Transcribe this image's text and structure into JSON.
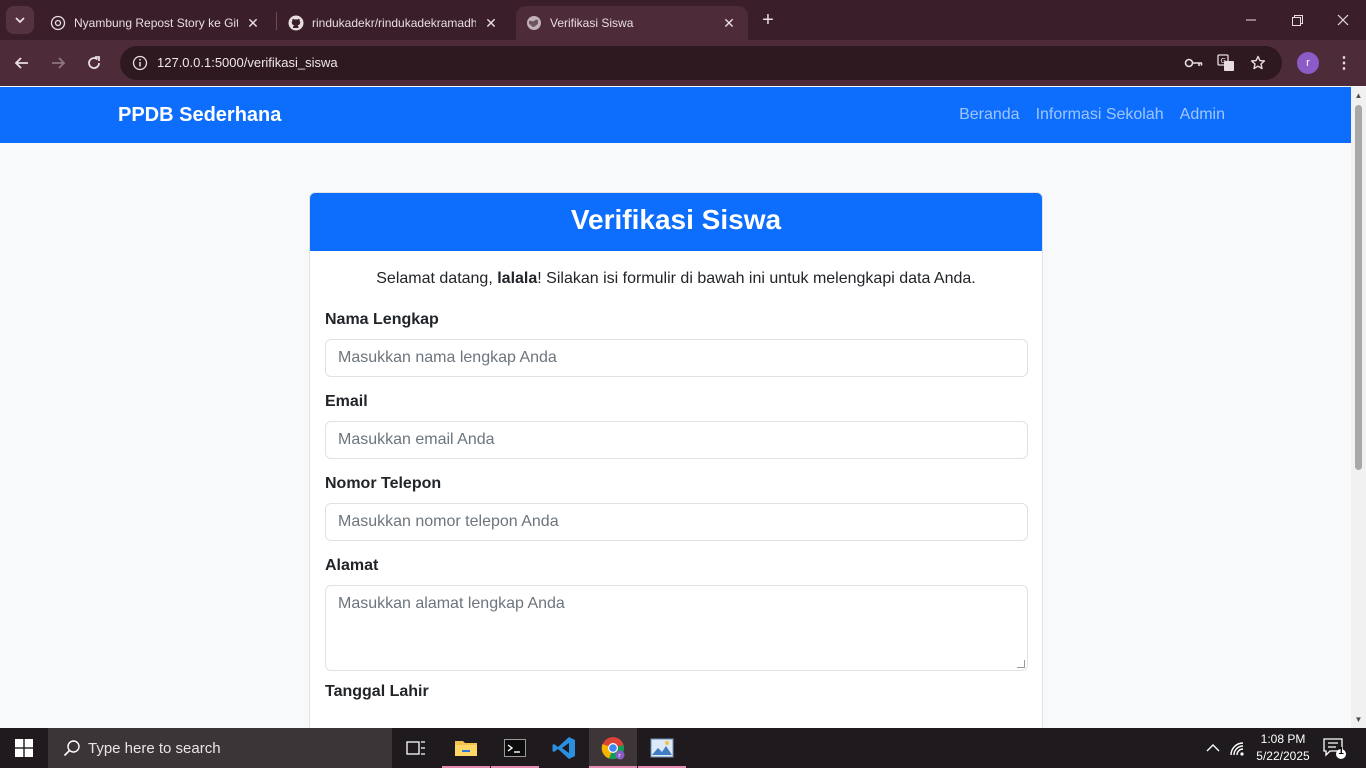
{
  "browser": {
    "tabs": [
      {
        "title": "Nyambung Repost Story ke GitHub",
        "favicon": "chatgpt-icon"
      },
      {
        "title": "rindukadekr/rindukadekramadhan",
        "favicon": "github-icon"
      },
      {
        "title": "Verifikasi Siswa",
        "favicon": "globe-icon",
        "active": true
      }
    ],
    "url": "127.0.0.1:5000/verifikasi_siswa",
    "profile_initial": "r"
  },
  "navbar": {
    "brand": "PPDB Sederhana",
    "links": [
      "Beranda",
      "Informasi Sekolah",
      "Admin"
    ]
  },
  "card": {
    "header": "Verifikasi Siswa",
    "welcome_prefix": "Selamat datang,",
    "username": "lalala",
    "welcome_suffix": "! Silakan isi formulir di bawah ini untuk melengkapi data Anda."
  },
  "form": {
    "fields": [
      {
        "label": "Nama Lengkap",
        "placeholder": "Masukkan nama lengkap Anda"
      },
      {
        "label": "Email",
        "placeholder": "Masukkan email Anda"
      },
      {
        "label": "Nomor Telepon",
        "placeholder": "Masukkan nomor telepon Anda"
      },
      {
        "label": "Alamat",
        "placeholder": "Masukkan alamat lengkap Anda"
      },
      {
        "label": "Tanggal Lahir"
      }
    ]
  },
  "taskbar": {
    "search_placeholder": "Type here to search",
    "time": "1:08 PM",
    "date": "5/22/2025",
    "notification_count": "1"
  },
  "colors": {
    "primary": "#0d6efd",
    "chrome_frame": "#3a1f2a",
    "chrome_toolbar": "#4e2b39"
  }
}
